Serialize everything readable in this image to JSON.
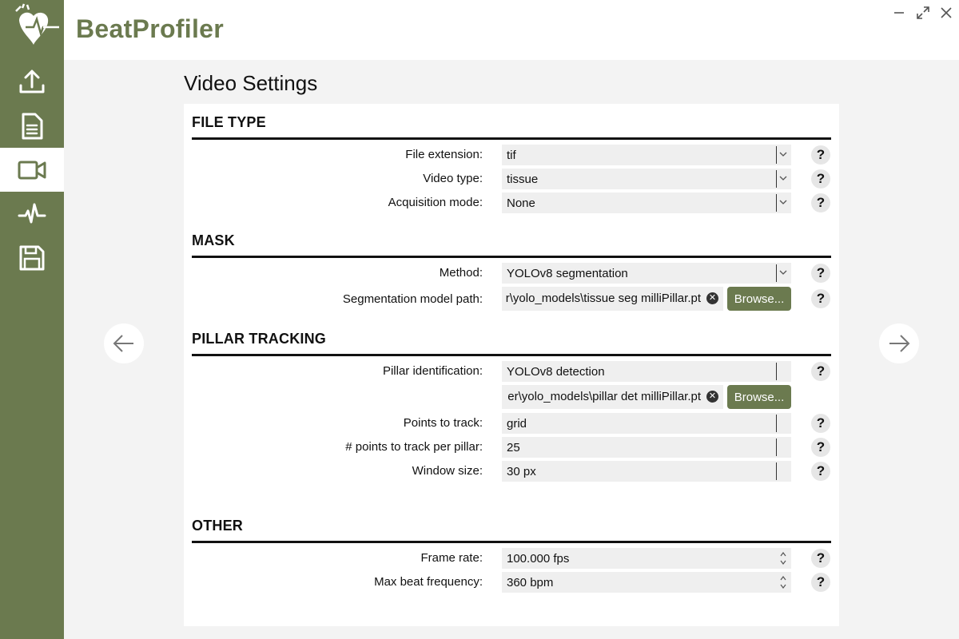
{
  "app": {
    "title": "BeatProfiler"
  },
  "window_controls": [
    "minimize-icon",
    "maximize-icon",
    "close-icon"
  ],
  "colors": {
    "brand": "#6b7a4f",
    "panel": "#ffffff",
    "background": "#f3f3f3"
  },
  "sidebar": {
    "items": [
      {
        "icon": "upload-icon",
        "active": false
      },
      {
        "icon": "document-icon",
        "active": false
      },
      {
        "icon": "video-camera-icon",
        "active": true
      },
      {
        "icon": "heartbeat-icon",
        "active": false
      },
      {
        "icon": "save-icon",
        "active": false
      }
    ]
  },
  "page": {
    "title": "Video Settings"
  },
  "sections": {
    "file_type": {
      "title": "FILE TYPE",
      "file_extension": {
        "label": "File extension:",
        "value": "tif"
      },
      "video_type": {
        "label": "Video type:",
        "value": "tissue"
      },
      "acquisition_mode": {
        "label": "Acquisition mode:",
        "value": "None"
      }
    },
    "mask": {
      "title": "MASK",
      "method": {
        "label": "Method:",
        "value": "YOLOv8 segmentation"
      },
      "model_path": {
        "label": "Segmentation model path:",
        "value": "r\\yolo_models\\tissue seg milliPillar.pt",
        "browse": "Browse..."
      }
    },
    "pillar_tracking": {
      "title": "PILLAR TRACKING",
      "identification": {
        "label": "Pillar identification:",
        "value": "YOLOv8 detection"
      },
      "model_path": {
        "value": "er\\yolo_models\\pillar det milliPillar.pt",
        "browse": "Browse..."
      },
      "points_to_track": {
        "label": "Points to track:",
        "value": "grid"
      },
      "points_per_pillar": {
        "label": "# points to track per pillar:",
        "value": "25"
      },
      "window_size": {
        "label": "Window size:",
        "value": "30 px"
      }
    },
    "other": {
      "title": "OTHER",
      "frame_rate": {
        "label": "Frame rate:",
        "value": "100.000 fps"
      },
      "max_beat_freq": {
        "label": "Max beat frequency:",
        "value": "360 bpm"
      }
    }
  },
  "help_glyph": "?",
  "clear_glyph": "✕"
}
